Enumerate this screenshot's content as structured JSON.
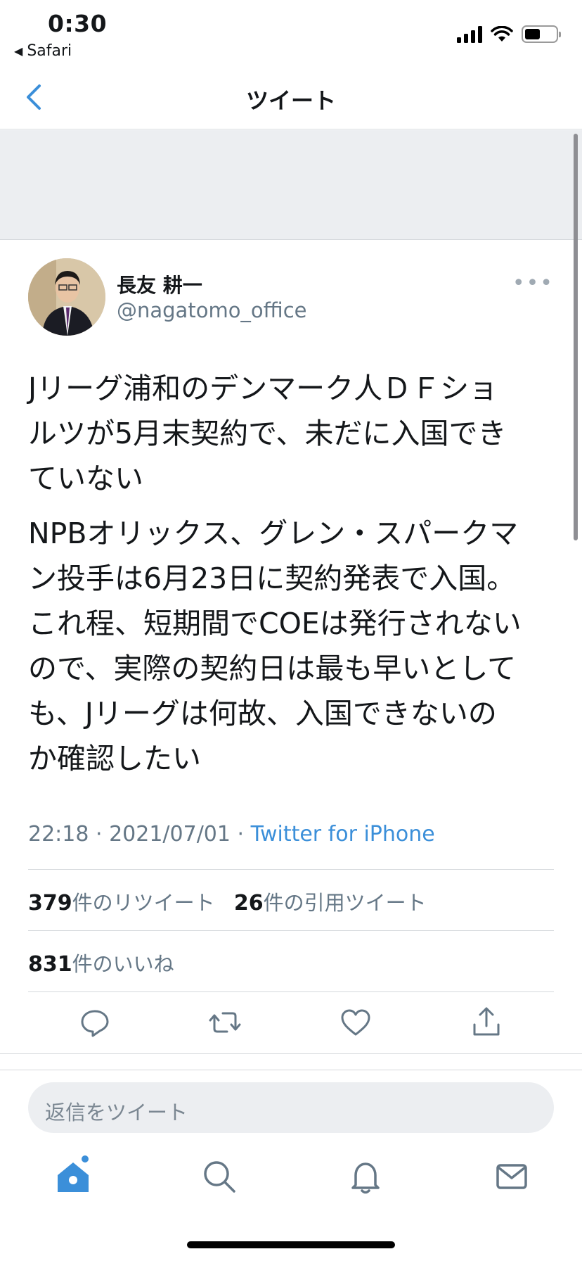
{
  "status_bar": {
    "time": "0:30",
    "back_app": "Safari",
    "battery_level": 0.5
  },
  "nav": {
    "title": "ツイート"
  },
  "tweet": {
    "author_name": "長友 耕一",
    "author_handle": "@nagatomo_office",
    "paragraphs": [
      "Jリーグ浦和のデンマーク人ＤＦショ\nルツが5月末契約で、未だに入国でき\nていない",
      "NPBオリックス、グレン・スパークマ\nン投手は6月23日に契約発表で入国。\nこれ程、短期間でCOEは発行されない\nので、実際の契約日は最も早いとして\nも、Jリーグは何故、入国できないの\nか確認したい"
    ],
    "timestamp": "22:18 · 2021/07/01 · ",
    "source": "Twitter for iPhone",
    "retweets_count": "379",
    "retweets_label": "件のリツイート",
    "quotes_count": "26",
    "quotes_label": "件の引用ツイート",
    "likes_count": "831",
    "likes_label": "件のいいね"
  },
  "reply": {
    "placeholder": "返信をツイート"
  },
  "colors": {
    "accent": "#3b8fd9",
    "muted": "#657786",
    "banner": "#eceef1"
  },
  "icons": {
    "actions": [
      "reply-icon",
      "retweet-icon",
      "like-icon",
      "share-icon"
    ],
    "tabs": [
      "home-icon",
      "search-icon",
      "notifications-icon",
      "messages-icon"
    ]
  }
}
